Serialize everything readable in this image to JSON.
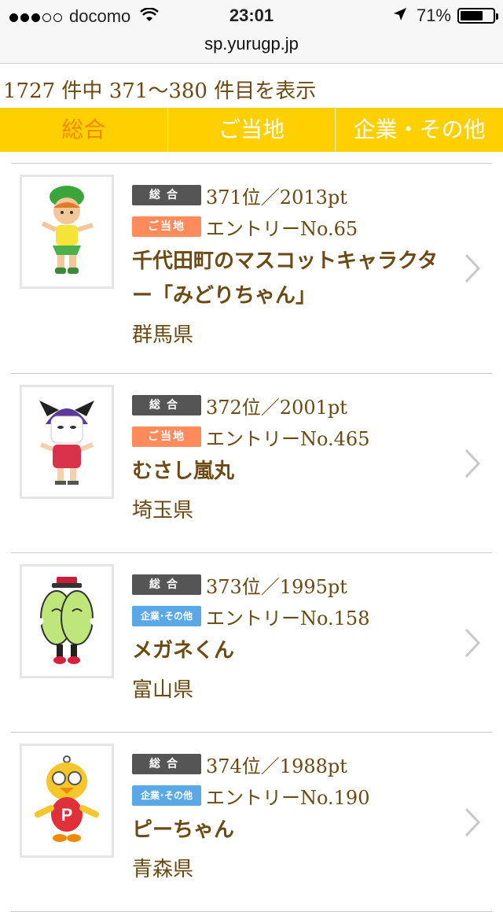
{
  "status_bar": {
    "carrier": "docomo",
    "time": "23:01",
    "battery": "71%",
    "battery_level": 0.71,
    "signal_bars": 3,
    "signal_total": 5
  },
  "url_bar": {
    "url": "sp.yurugp.jp"
  },
  "result_count": "1727 件中 371〜380 件目を表示",
  "tabs": [
    {
      "label": "総合",
      "active": true
    },
    {
      "label": "ご当地",
      "active": false
    },
    {
      "label": "企業・その他",
      "active": false
    }
  ],
  "badges": {
    "overall": "総合",
    "local": "ご当地",
    "company": "企業･その他"
  },
  "items": [
    {
      "rank": "371位／2013pt",
      "entry": "エントリーNo.65",
      "category": "local",
      "name": "千代田町のマスコットキャラクター「みどりちゃん」",
      "prefecture": "群馬県",
      "thumb_icon": "midori-chan-mascot-icon"
    },
    {
      "rank": "372位／2001pt",
      "entry": "エントリーNo.465",
      "category": "local",
      "name": "むさし嵐丸",
      "prefecture": "埼玉県",
      "thumb_icon": "musashi-ranmaru-mascot-icon"
    },
    {
      "rank": "373位／1995pt",
      "entry": "エントリーNo.158",
      "category": "company",
      "name": "メガネくん",
      "prefecture": "富山県",
      "thumb_icon": "megane-kun-mascot-icon"
    },
    {
      "rank": "374位／1988pt",
      "entry": "エントリーNo.190",
      "category": "company",
      "name": "ピーちゃん",
      "prefecture": "青森県",
      "thumb_icon": "pii-chan-mascot-icon"
    }
  ],
  "colors": {
    "tab_bar": "#ffd000",
    "active_tab_text": "#f08a00",
    "text_brown": "#6b4a14",
    "badge_overall": "#555555",
    "badge_local": "#ff8a5c",
    "badge_company": "#5aa9e6"
  }
}
